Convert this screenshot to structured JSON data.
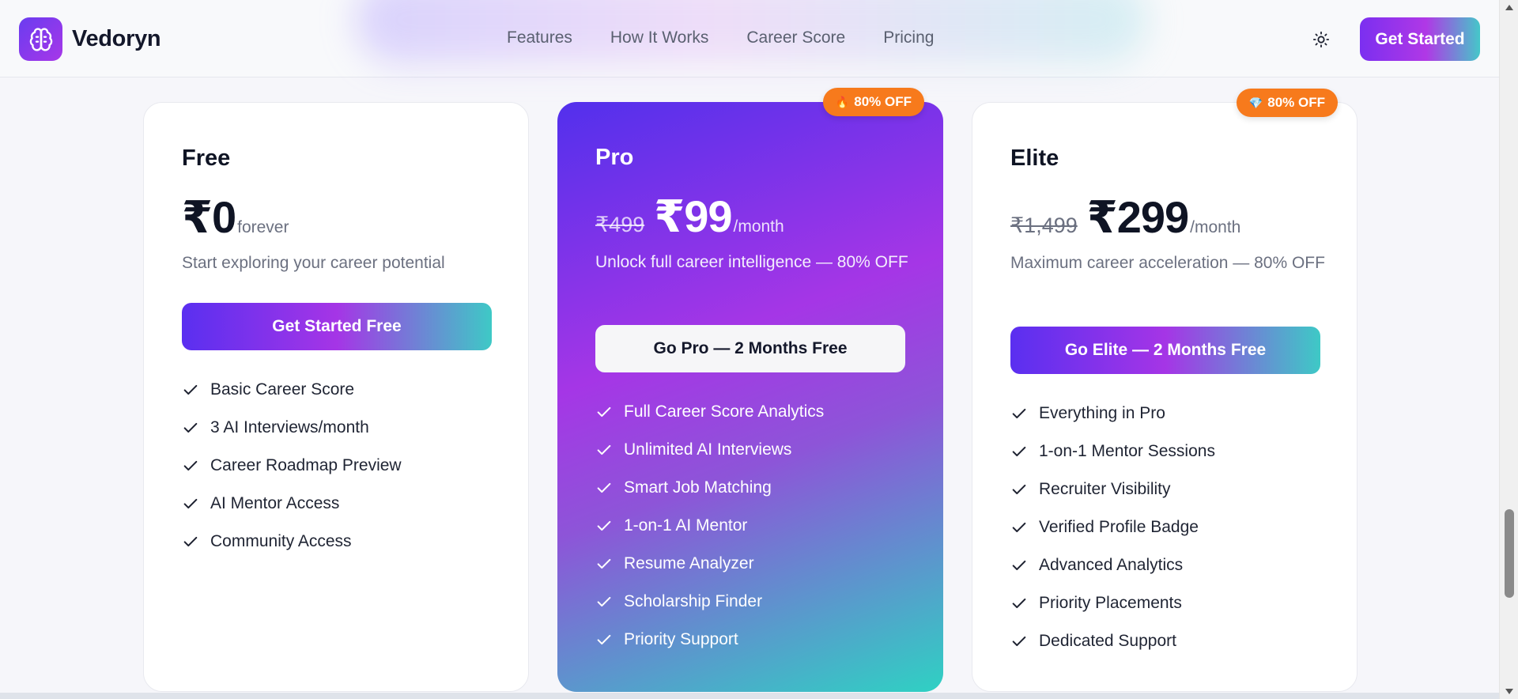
{
  "header": {
    "brand": "Vedoryn",
    "nav": [
      "Features",
      "How It Works",
      "Career Score",
      "Pricing"
    ],
    "cta_label": "Get Started"
  },
  "plans": [
    {
      "name": "Free",
      "old_price": "",
      "price": "₹0",
      "period": "forever",
      "tagline": "Start exploring your career potential",
      "button": "Get Started Free",
      "badge": "",
      "features": [
        "Basic Career Score",
        "3 AI Interviews/month",
        "Career Roadmap Preview",
        "AI Mentor Access",
        "Community Access"
      ]
    },
    {
      "name": "Pro",
      "old_price": "₹499",
      "price": "₹99",
      "period": "/month",
      "tagline": "Unlock full career intelligence — 80% OFF",
      "button": "Go Pro — 2 Months Free",
      "badge": "80% OFF",
      "badge_icon": "🔥",
      "features": [
        "Full Career Score Analytics",
        "Unlimited AI Interviews",
        "Smart Job Matching",
        "1-on-1 AI Mentor",
        "Resume Analyzer",
        "Scholarship Finder",
        "Priority Support"
      ]
    },
    {
      "name": "Elite",
      "old_price": "₹1,499",
      "price": "₹299",
      "period": "/month",
      "tagline": "Maximum career acceleration — 80% OFF",
      "button": "Go Elite — 2 Months Free",
      "badge": "80% OFF",
      "badge_icon": "💎",
      "features": [
        "Everything in Pro",
        "1-on-1 Mentor Sessions",
        "Recruiter Visibility",
        "Verified Profile Badge",
        "Advanced Analytics",
        "Priority Placements",
        "Dedicated Support"
      ]
    }
  ],
  "colors": {
    "accent_purple": "#a536e6",
    "accent_teal": "#3ec9c6",
    "badge_orange": "#f77a1c"
  }
}
